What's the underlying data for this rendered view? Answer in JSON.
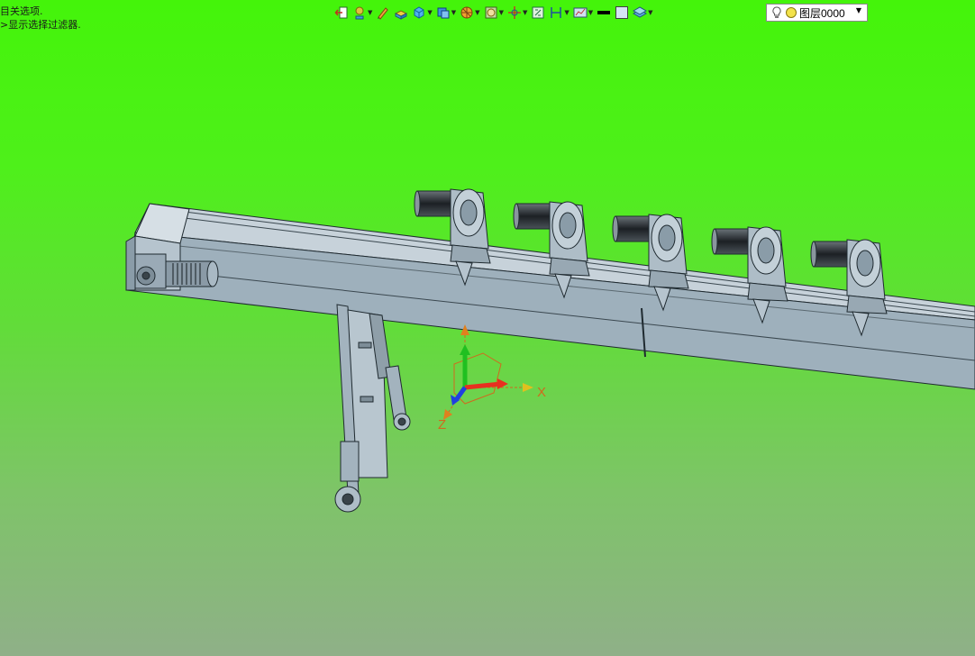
{
  "status_hints": {
    "line1": "目关选项.",
    "line2": ">显示选择过滤器."
  },
  "toolbar": {
    "tools": [
      {
        "icon": "exit-sketch-icon",
        "dropdown": false
      },
      {
        "icon": "snap-icon",
        "dropdown": true
      },
      {
        "icon": "pencil-icon",
        "dropdown": false
      },
      {
        "icon": "extrude-icon",
        "dropdown": false
      },
      {
        "icon": "solid-box-icon",
        "dropdown": true
      },
      {
        "icon": "view-cube-icon",
        "dropdown": true
      },
      {
        "icon": "section-view-icon",
        "dropdown": true
      },
      {
        "icon": "render-style-icon",
        "dropdown": true
      },
      {
        "icon": "move-icon",
        "dropdown": true
      },
      {
        "icon": "fit-view-icon",
        "dropdown": false
      },
      {
        "icon": "measure-icon",
        "dropdown": true
      },
      {
        "icon": "analysis-icon",
        "dropdown": true
      },
      {
        "icon": "line-color-icon",
        "dropdown": false
      },
      {
        "icon": "face-color-icon",
        "dropdown": false
      },
      {
        "icon": "layer-stack-icon",
        "dropdown": true
      }
    ],
    "layer_selector": {
      "value": "图层0000"
    }
  },
  "triad": {
    "x_label": "X",
    "z_label": "Z"
  },
  "colors": {
    "background_top": "#44f40a",
    "background_bottom": "#8fb088",
    "model_fill": "#a9b9c4",
    "model_edge": "#1f2a30",
    "axis_x": "#e83020",
    "axis_y": "#20c020",
    "axis_z": "#2040e0"
  }
}
